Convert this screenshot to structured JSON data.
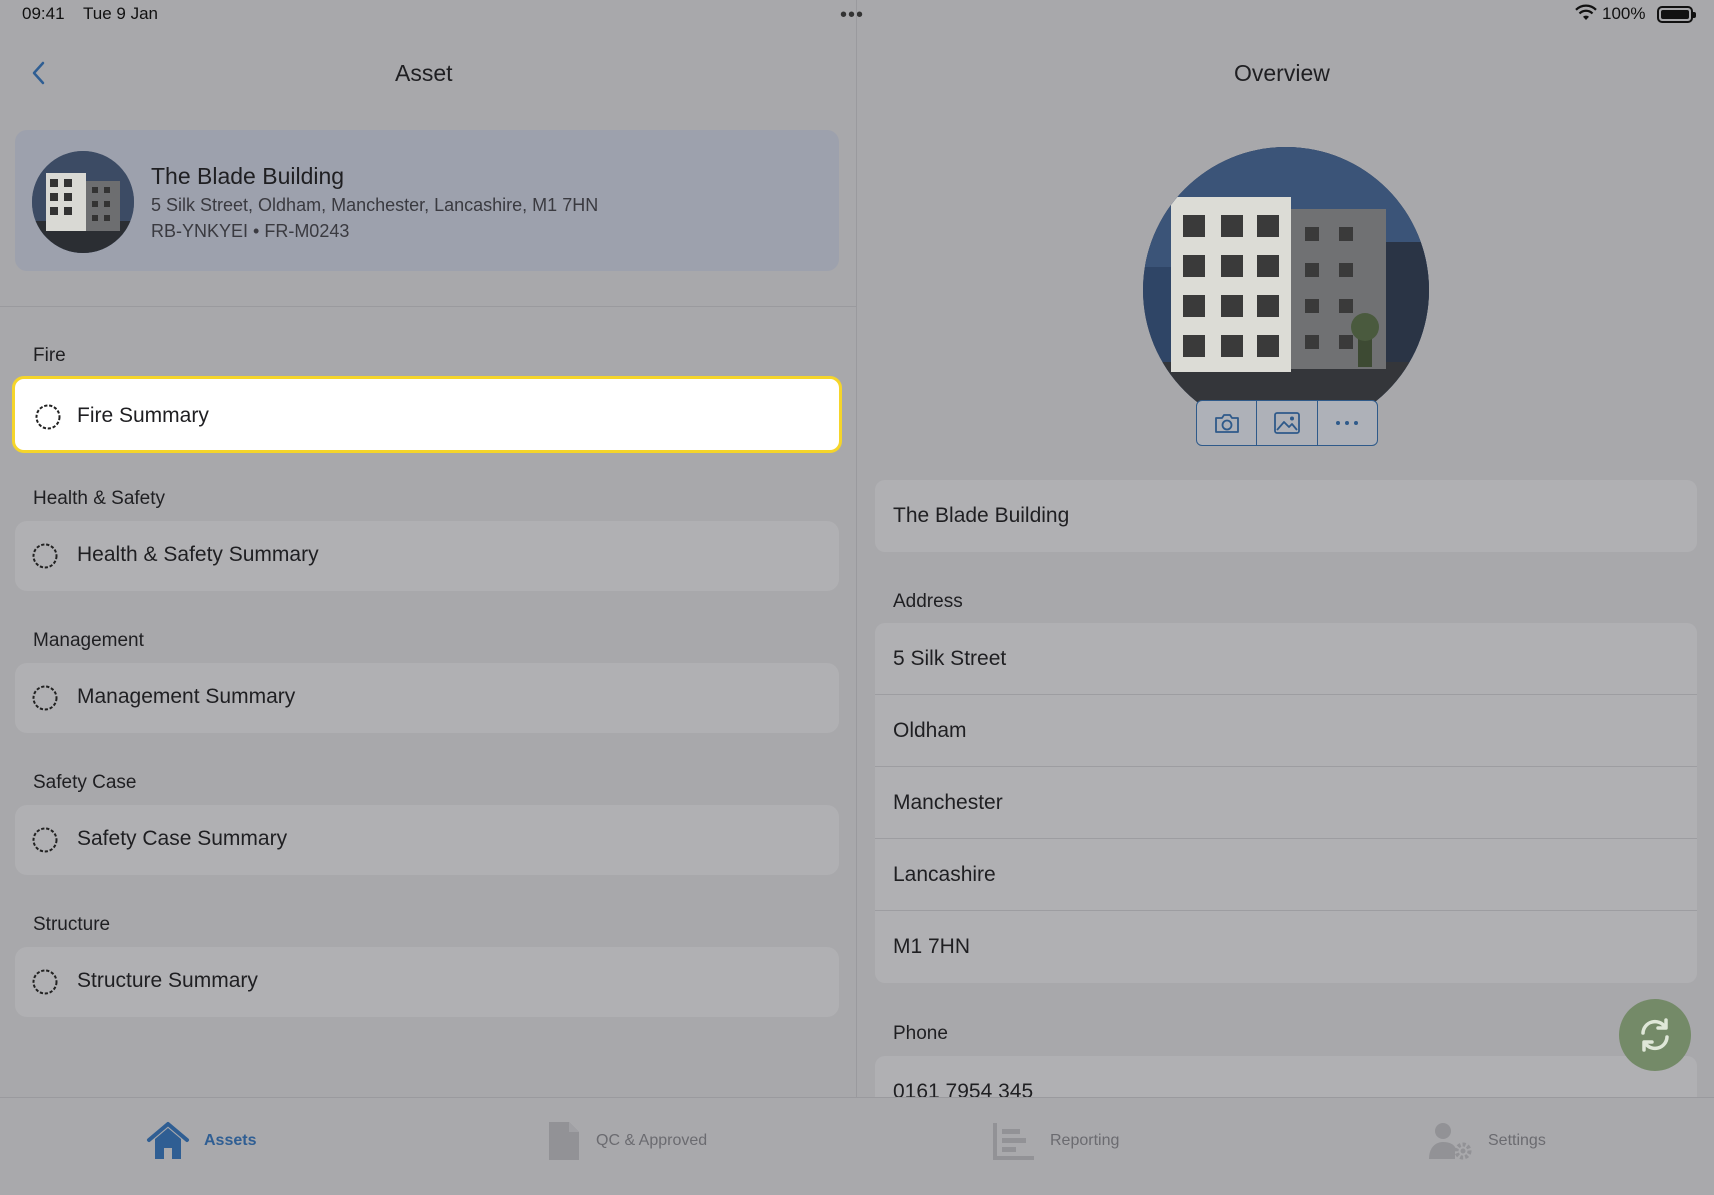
{
  "status_bar": {
    "time": "09:41",
    "date": "Tue 9 Jan",
    "battery": "100%"
  },
  "left": {
    "title": "Asset",
    "asset": {
      "name": "The Blade Building",
      "address": "5 Silk Street, Oldham, Manchester, Lancashire, M1 7HN",
      "codes": "RB-YNKYEI • FR-M0243"
    },
    "sections": [
      {
        "header": "Fire",
        "item": "Fire Summary"
      },
      {
        "header": "Health & Safety",
        "item": "Health & Safety Summary"
      },
      {
        "header": "Management",
        "item": "Management Summary"
      },
      {
        "header": "Safety Case",
        "item": "Safety Case Summary"
      },
      {
        "header": "Structure",
        "item": "Structure Summary"
      }
    ]
  },
  "right": {
    "title": "Overview",
    "name_field": "The Blade Building",
    "address_label": "Address",
    "address_lines": [
      "5 Silk Street",
      "Oldham",
      "Manchester",
      "Lancashire",
      "M1 7HN"
    ],
    "phone_label": "Phone",
    "phone": "0161 7954 345"
  },
  "tabs": [
    {
      "label": "Assets",
      "icon": "house-icon",
      "active": true
    },
    {
      "label": "QC & Approved",
      "icon": "document-icon",
      "active": false
    },
    {
      "label": "Reporting",
      "icon": "report-icon",
      "active": false
    },
    {
      "label": "Settings",
      "icon": "user-gear-icon",
      "active": false
    }
  ],
  "colors": {
    "accent": "#2f5e93",
    "highlight_border": "#f5d52a",
    "sync_button": "#748a68"
  }
}
